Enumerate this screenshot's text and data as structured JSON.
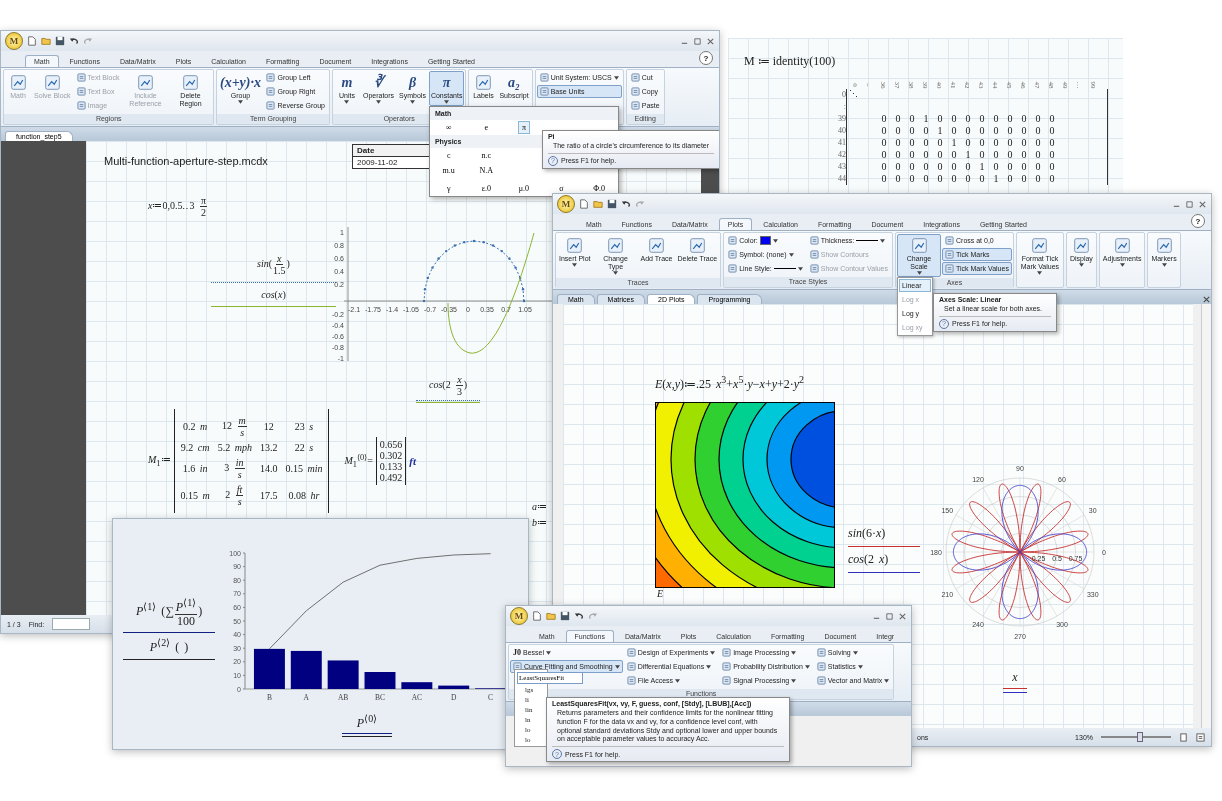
{
  "main_window": {
    "logo": "M",
    "help": "?",
    "tabs": [
      {
        "label": "Math",
        "selected": true
      },
      {
        "label": "Functions",
        "selected": false
      },
      {
        "label": "Data/Matrix",
        "selected": false
      },
      {
        "label": "Plots",
        "selected": false
      },
      {
        "label": "Calculation",
        "selected": false
      },
      {
        "label": "Formatting",
        "selected": false
      },
      {
        "label": "Document",
        "selected": false
      },
      {
        "label": "Integrations",
        "selected": false
      },
      {
        "label": "Getting Started",
        "selected": false
      }
    ],
    "ribbon_groups": [
      {
        "label": "Regions",
        "items": [
          {
            "kind": "large",
            "label": "Math",
            "disabled": true
          },
          {
            "kind": "large",
            "label": "Solve Block",
            "disabled": true
          },
          {
            "kind": "small",
            "label": "Text Block",
            "disabled": true
          },
          {
            "kind": "small",
            "label": "Text Box",
            "disabled": true
          },
          {
            "kind": "small",
            "label": "Image",
            "disabled": true
          },
          {
            "kind": "large",
            "label": "Include Reference",
            "disabled": true
          },
          {
            "kind": "large",
            "label": "Delete Region",
            "disabled": false
          }
        ]
      },
      {
        "label": "Term Grouping",
        "items": [
          {
            "kind": "large",
            "label": "Group",
            "glyph": "(x+y)·x",
            "dropdown": true
          },
          {
            "kind": "small",
            "label": "Group Left"
          },
          {
            "kind": "small",
            "label": "Group Right"
          },
          {
            "kind": "small",
            "label": "Reverse Group"
          }
        ]
      },
      {
        "label": "Operators",
        "items": [
          {
            "kind": "large",
            "label": "Units",
            "glyph": "m",
            "dropdown": true,
            "pressed": false
          },
          {
            "kind": "large",
            "label": "Operators",
            "glyph": "∛",
            "dropdown": true,
            "pressed": false
          },
          {
            "kind": "large",
            "label": "Symbols",
            "glyph": "β",
            "dropdown": true,
            "pressed": false
          },
          {
            "kind": "large",
            "label": "Constants",
            "glyph": "π",
            "dropdown": true,
            "pressed": true
          }
        ]
      },
      {
        "items": [
          {
            "kind": "large",
            "label": "Labels"
          },
          {
            "kind": "large",
            "label": "Subscript",
            "glyph": "a₂"
          }
        ]
      },
      {
        "items": [
          {
            "kind": "small",
            "label": "Unit System: USCS",
            "dropdown": true,
            "pressed": false
          },
          {
            "kind": "small",
            "label": "Base Units",
            "pressed": true
          }
        ]
      },
      {
        "label": "Editing",
        "items": [
          {
            "kind": "small",
            "label": "Cut"
          },
          {
            "kind": "small",
            "label": "Copy"
          },
          {
            "kind": "small",
            "label": "Paste"
          }
        ]
      }
    ],
    "doc_tab": "function_step5",
    "doc_title": "Multi-function-aperture-step.mcdx",
    "date_table": {
      "header": "Date",
      "value": "2009-11-02"
    },
    "range_expr": [
      {
        "text": "*x*≔0,0.5‥3 "
      },
      {
        "num": "π",
        "den": "2"
      }
    ],
    "legend": [
      {
        "parts": [
          {
            "text": "*sin*("
          },
          {
            "num": "*x*",
            "den": "1.5"
          },
          {
            "text": ")"
          }
        ]
      },
      {
        "parts": [
          {
            "text": "*cos*(*x*)"
          }
        ]
      }
    ],
    "plot_x_ticks": [
      "-2.1",
      "-1.75",
      "-1.4",
      "-1.05",
      "-0.7",
      "-0.35",
      "0",
      "0.35",
      "0.7",
      "1.05"
    ],
    "plot_y_ticks": [
      "1",
      "0.8",
      "0.6",
      "0.4",
      "0.2",
      "-0.2",
      "-0.4",
      "-0.6",
      "-0.8",
      "-1"
    ],
    "plot_x_label": [
      {
        "text": "*cos*(2 "
      },
      {
        "num": "*x*",
        "den": "3"
      },
      {
        "text": ")"
      }
    ],
    "matrix_lhs": "*M*$_{1}$≔",
    "matrix_rows": [
      [
        [
          {
            "text": "0.2 *m*"
          }
        ],
        [
          {
            "text": "12 "
          },
          {
            "num": "*m*",
            "den": "*s*"
          }
        ],
        [
          {
            "text": "12"
          }
        ],
        [
          {
            "text": "23 *s*"
          }
        ]
      ],
      [
        [
          {
            "text": "9.2 *cm*"
          }
        ],
        [
          {
            "text": "5.2 *mph*"
          }
        ],
        [
          {
            "text": "13.2"
          }
        ],
        [
          {
            "text": "22 *s*"
          }
        ]
      ],
      [
        [
          {
            "text": "1.6 *in*"
          }
        ],
        [
          {
            "text": "3 "
          },
          {
            "num": "*in*",
            "den": "*s*"
          }
        ],
        [
          {
            "text": "14.0"
          }
        ],
        [
          {
            "text": "0.15 *min*"
          }
        ]
      ],
      [
        [
          {
            "text": "0.15 *m*"
          }
        ],
        [
          {
            "text": "2 "
          },
          {
            "num": "*ft*",
            "den": "*s*"
          }
        ],
        [
          {
            "text": "17.5"
          }
        ],
        [
          {
            "text": "0.08 *hr*"
          }
        ]
      ]
    ],
    "column_lhs": "*M*$_{1}$$^{⟨0⟩}$=",
    "column_values": [
      "0.656",
      "0.302",
      "0.133",
      "0.492"
    ],
    "column_unit": "ft",
    "assignments": [
      "*a*≔",
      "*b*≔"
    ],
    "status": {
      "page": "1 / 3",
      "find_label": "Find:"
    },
    "constants_menu": {
      "sections": [
        {
          "title": "Math",
          "rows": [
            [
              {
                "label": "∞",
                "selected": false
              },
              {
                "label": "e",
                "selected": false
              },
              {
                "label": "π",
                "selected": true
              }
            ]
          ]
        },
        {
          "title": "Physics",
          "rows": [
            [
              {
                "label": "c",
                "selected": false
              },
              {
                "label": "n.c",
                "selected": false
              }
            ],
            [
              {
                "label": "m.u",
                "selected": false
              },
              {
                "label": "N.A",
                "selected": false
              }
            ],
            [
              {
                "label": "γ",
                "selected": false
              },
              {
                "label": "ε.0",
                "selected": false
              },
              {
                "label": "μ.0",
                "selected": false
              },
              {
                "label": "σ",
                "selected": false
              },
              {
                "label": "Φ.0",
                "selected": false
              }
            ]
          ]
        }
      ]
    },
    "tooltip": {
      "title": "Pi",
      "text": "The ratio of a circle's circumference to its diameter",
      "help_mark": "?",
      "help": "Press F1 for help."
    }
  },
  "identity_region": {
    "definition": "M ≔ identity(100)",
    "column_headers": [
      "0",
      "‥",
      "36",
      "37",
      "38",
      "39",
      "40",
      "41",
      "42",
      "43",
      "44",
      "45",
      "46",
      "47",
      "48",
      "49",
      "…",
      "99"
    ],
    "top_rows": [
      {
        "label": "0",
        "mark": "⋱"
      },
      {
        "label": ":"
      }
    ],
    "rows": [
      {
        "label": "39",
        "values": [
          "0",
          "0",
          "0",
          "1",
          "0",
          "0",
          "0",
          "0",
          "0",
          "0",
          "0",
          "0",
          "0"
        ]
      },
      {
        "label": "40",
        "values": [
          "0",
          "0",
          "0",
          "0",
          "1",
          "0",
          "0",
          "0",
          "0",
          "0",
          "0",
          "0",
          "0"
        ]
      },
      {
        "label": "41",
        "values": [
          "0",
          "0",
          "0",
          "0",
          "0",
          "1",
          "0",
          "0",
          "0",
          "0",
          "0",
          "0",
          "0"
        ]
      },
      {
        "label": "42",
        "values": [
          "0",
          "0",
          "0",
          "0",
          "0",
          "0",
          "1",
          "0",
          "0",
          "0",
          "0",
          "0",
          "0"
        ]
      },
      {
        "label": "43",
        "values": [
          "0",
          "0",
          "0",
          "0",
          "0",
          "0",
          "0",
          "1",
          "0",
          "0",
          "0",
          "0",
          "0"
        ]
      },
      {
        "label": "44",
        "values": [
          "0",
          "0",
          "0",
          "0",
          "0",
          "0",
          "0",
          "0",
          "1",
          "0",
          "0",
          "0",
          "0"
        ]
      }
    ]
  },
  "plots_window": {
    "logo": "M",
    "help": "?",
    "tabs": [
      {
        "label": "Math",
        "selected": false
      },
      {
        "label": "Functions",
        "selected": false
      },
      {
        "label": "Data/Matrix",
        "selected": false
      },
      {
        "label": "Plots",
        "selected": true
      },
      {
        "label": "Calculation",
        "selected": false
      },
      {
        "label": "Formatting",
        "selected": false
      },
      {
        "label": "Document",
        "selected": false
      },
      {
        "label": "Integrations",
        "selected": false
      },
      {
        "label": "Getting Started",
        "selected": false
      }
    ],
    "ribbon_groups": [
      {
        "label": "Traces",
        "items": [
          {
            "kind": "large",
            "label": "Insert Plot",
            "dropdown": true
          },
          {
            "kind": "large",
            "label": "Change Type",
            "dropdown": true
          },
          {
            "kind": "large",
            "label": "Add Trace"
          },
          {
            "kind": "large",
            "label": "Delete Trace"
          }
        ]
      },
      {
        "label": "Trace Styles",
        "items": [
          {
            "kind": "small",
            "label": "Color:",
            "color": "#0000ee",
            "dropdown": true,
            "disabled": false
          },
          {
            "kind": "small",
            "label": "Symbol: (none)",
            "dropdown": true,
            "disabled": false
          },
          {
            "kind": "small",
            "label": "Line Style:",
            "line": true,
            "dropdown": true,
            "disabled": false
          },
          {
            "kind": "small",
            "label": "Thickness:",
            "line": true,
            "dropdown": true,
            "disabled": false
          },
          {
            "kind": "small",
            "label": "Show Contours",
            "disabled": true
          },
          {
            "kind": "small",
            "label": "Show Contour Values",
            "disabled": true
          }
        ]
      },
      {
        "label": "Axes",
        "items": [
          {
            "kind": "large",
            "label": "Change Scale",
            "dropdown": true,
            "pressed": true
          },
          {
            "kind": "small",
            "label": "Cross at 0,0",
            "pressed": false
          },
          {
            "kind": "small",
            "label": "Tick Marks",
            "pressed": true
          },
          {
            "kind": "small",
            "label": "Tick Mark Values",
            "pressed": true
          }
        ]
      },
      {
        "items": [
          {
            "kind": "large",
            "label": "Format Tick Mark Values",
            "dropdown": true
          }
        ]
      },
      {
        "items": [
          {
            "kind": "large",
            "label": "Display",
            "dropdown": true
          }
        ]
      },
      {
        "items": [
          {
            "kind": "large",
            "label": "Adjustments",
            "dropdown": true
          }
        ]
      },
      {
        "items": [
          {
            "kind": "large",
            "label": "Markers",
            "dropdown": true
          }
        ]
      }
    ],
    "doc_tabs": [
      {
        "label": "Math",
        "selected": false
      },
      {
        "label": "Matrices",
        "selected": false
      },
      {
        "label": "2D Plots",
        "selected": true
      },
      {
        "label": "Programming",
        "selected": false
      }
    ],
    "scale_menu": [
      {
        "label": "Linear",
        "selected": true,
        "disabled": false
      },
      {
        "label": "Log x",
        "selected": false,
        "disabled": true
      },
      {
        "label": "Log y",
        "selected": false,
        "disabled": false
      },
      {
        "label": "Log xy",
        "selected": false,
        "disabled": true
      }
    ],
    "tooltip": {
      "title": "Axes Scale: Linear",
      "text": "Set a linear scale for both axes.",
      "help_mark": "?",
      "help": "Press F1 for help."
    },
    "function_def": "*E*(*x*,*y*)≔.25 *x*$^{3}$+*x*$^{5}$·*y*−*x*+*y*+2·*y*$^{2}$",
    "contour_label": "E",
    "legend": [
      "*sin*(6·*x*)",
      "*cos*(2 *x*)"
    ],
    "polar_angle_labels": [
      "0",
      "30",
      "60",
      "90",
      "120",
      "150",
      "180",
      "210",
      "240",
      "270",
      "300",
      "330"
    ],
    "polar_radial_labels": [
      "0.25",
      "0.5",
      "0.75"
    ],
    "polar_x_label": "x",
    "status": {
      "options": "ons",
      "zoom": "130%",
      "zoom_slider": {
        "level": 0.55
      }
    }
  },
  "pareto_window": {
    "chart_data": {
      "type": "bar",
      "categories": [
        "B",
        "A",
        "AB",
        "BC",
        "AC",
        "D",
        "C"
      ],
      "series": [
        {
          "type": "bar",
          "color": "#000080",
          "values": [
            29.5,
            28,
            21,
            12.5,
            5,
            2.5,
            0.5
          ]
        },
        {
          "type": "line",
          "color": "#707070",
          "values": [
            29.5,
            57.5,
            78.5,
            91,
            96,
            98.5,
            99.5
          ]
        }
      ],
      "ylim": [
        0,
        100
      ],
      "yticks": [
        0,
        10,
        20,
        30,
        40,
        50,
        60,
        70,
        80,
        90,
        100
      ]
    },
    "y_labels": [
      [
        {
          "text": "*P*$^{⟨1⟩}$ (∑"
        },
        {
          "num": "*P*$^{⟨1⟩}$",
          "den": "100"
        },
        {
          "text": ")"
        }
      ],
      [
        {
          "text": "*P*$^{⟨2⟩}$ ( )"
        }
      ]
    ],
    "x_label": "*P*$^{⟨0⟩}$"
  },
  "functions_window": {
    "logo": "M",
    "tabs": [
      {
        "label": "Math",
        "selected": false
      },
      {
        "label": "Functions",
        "selected": true
      },
      {
        "label": "Data/Matrix",
        "selected": false
      },
      {
        "label": "Plots",
        "selected": false
      },
      {
        "label": "Calculation",
        "selected": false
      },
      {
        "label": "Formatting",
        "selected": false
      },
      {
        "label": "Document",
        "selected": false
      },
      {
        "label": "Integr",
        "selected": false
      }
    ],
    "ribbon_groups": [
      {
        "label": "Functions",
        "columns": [
          [
            {
              "kind": "small",
              "label": "Bessel",
              "glyph": "J0",
              "dropdown": true,
              "pressed": false
            },
            {
              "kind": "small",
              "label": "Curve Fitting and Smoothing",
              "dropdown": true,
              "pressed": true
            }
          ],
          [
            {
              "kind": "small",
              "label": "Design of Experiments",
              "dropdown": true
            },
            {
              "kind": "small",
              "label": "Differential Equations",
              "dropdown": true
            },
            {
              "kind": "small",
              "label": "File Access",
              "dropdown": true
            }
          ],
          [
            {
              "kind": "small",
              "label": "Image Processing",
              "dropdown": true
            },
            {
              "kind": "small",
              "label": "Probability Distribution",
              "dropdown": true
            },
            {
              "kind": "small",
              "label": "Signal Processing",
              "dropdown": true
            }
          ],
          [
            {
              "kind": "small",
              "label": "Solving",
              "dropdown": true
            },
            {
              "kind": "small",
              "label": "Statistics",
              "dropdown": true
            },
            {
              "kind": "small",
              "label": "Vector and Matrix",
              "dropdown": true
            }
          ]
        ]
      }
    ],
    "function_field": "LeastSquaresFit",
    "function_list": [
      "lgs",
      "li",
      "lin",
      "ln",
      "lo",
      "lo"
    ],
    "tooltip": {
      "title": "LeastSquaresFit(vx, vy, F, guess, conf, [Stdy], [LBUB],[Acc])",
      "text": "Returns parameters and their confidence limits for the nonlinear fitting function F for the data vx and vy, for a confidence level conf, with optional standard deviations Stdy and optional lower and upper bounds on acceptable parameter values to accuracy Acc.",
      "help_mark": "?",
      "help": "Press F1 for help."
    }
  }
}
